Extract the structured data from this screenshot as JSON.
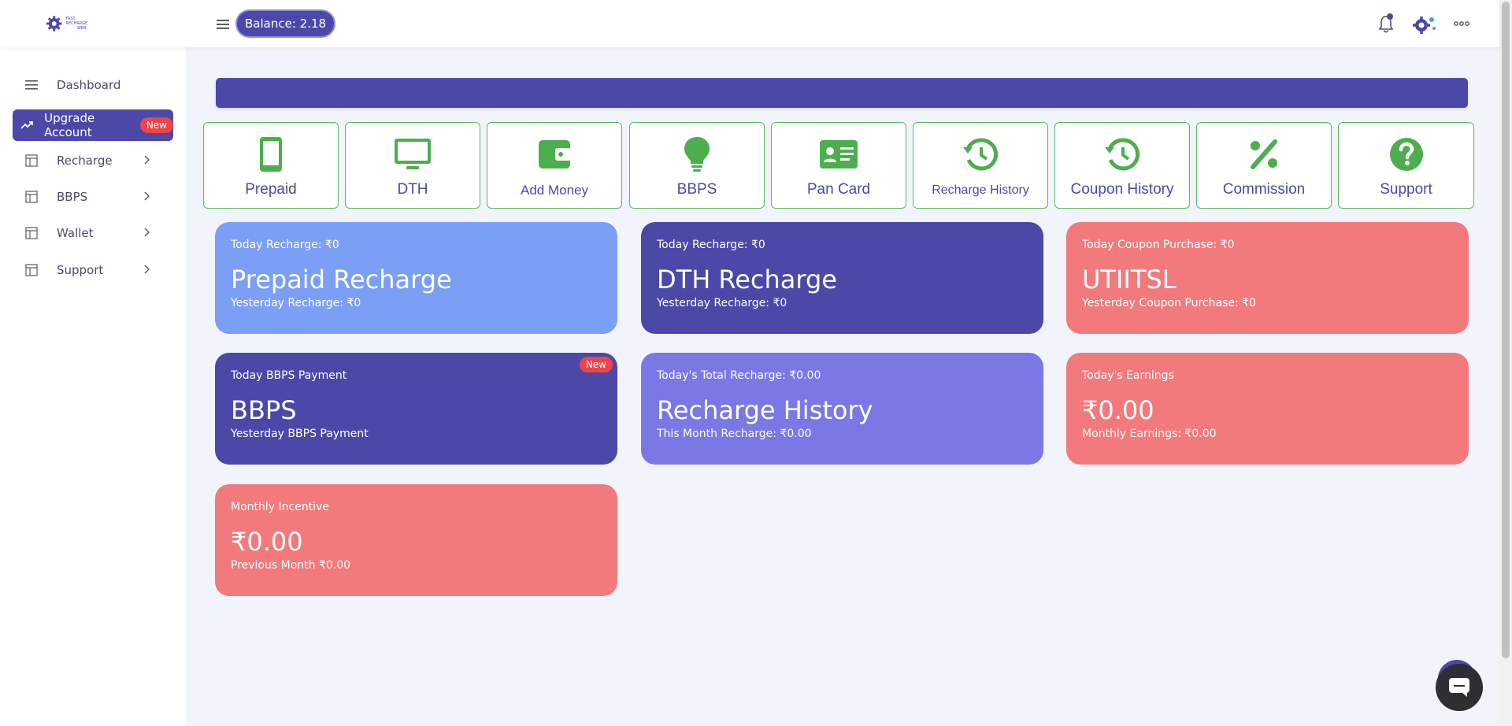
{
  "header": {
    "logo_text_1": "FAST RECHARGE",
    "logo_text_2": "WEB",
    "balance": "Balance: 2.18"
  },
  "sidebar": {
    "items": [
      {
        "label": "Dashboard",
        "icon": "menu-icon"
      },
      {
        "label": "Upgrade Account",
        "icon": "trend-up-icon",
        "badge": "New"
      },
      {
        "label": "Recharge",
        "icon": "table-icon"
      },
      {
        "label": "BBPS",
        "icon": "table-icon"
      },
      {
        "label": "Wallet",
        "icon": "table-icon"
      },
      {
        "label": "Support",
        "icon": "table-icon"
      }
    ]
  },
  "services": [
    {
      "label": "Prepaid",
      "icon": "mobile-icon"
    },
    {
      "label": "DTH",
      "icon": "tv-icon"
    },
    {
      "label": "Add Money",
      "icon": "wallet-icon"
    },
    {
      "label": "BBPS",
      "icon": "bulb-icon"
    },
    {
      "label": "Pan Card",
      "icon": "id-card-icon"
    },
    {
      "label": "Recharge History",
      "icon": "history-icon"
    },
    {
      "label": "Coupon History",
      "icon": "history-icon"
    },
    {
      "label": "Commission",
      "icon": "percent-icon"
    },
    {
      "label": "Support",
      "icon": "question-icon"
    }
  ],
  "cards": [
    {
      "top": "Today Recharge: ₹0",
      "big": "Prepaid Recharge",
      "bottom": "Yesterday Recharge: ₹0"
    },
    {
      "top": "Today Recharge: ₹0",
      "big": "DTH Recharge",
      "bottom": "Yesterday Recharge: ₹0"
    },
    {
      "top": "Today Coupon Purchase: ₹0",
      "big": "UTIITSL",
      "bottom": "Yesterday Coupon Purchase: ₹0"
    },
    {
      "top": "Today BBPS Payment",
      "big": "BBPS",
      "bottom": "Yesterday BBPS Payment",
      "badge": "New"
    },
    {
      "top": "Today's Total Recharge: ₹0.00",
      "big": "Recharge History",
      "bottom": "This Month Recharge: ₹0.00"
    },
    {
      "top": "Today's Earnings",
      "big": "₹0.00",
      "bottom": "Monthly Earnings: ₹0.00"
    },
    {
      "top": "Monthly Incentive",
      "big": "₹0.00",
      "bottom": "Previous Month ₹0.00"
    }
  ],
  "colors": {
    "primary": "#4b48a8",
    "accent_green": "#5cb85c",
    "card_light_blue": "#7b9ff4",
    "card_red": "#f27a7c",
    "card_violet": "#7978e5",
    "badge_red": "#ef4545"
  }
}
